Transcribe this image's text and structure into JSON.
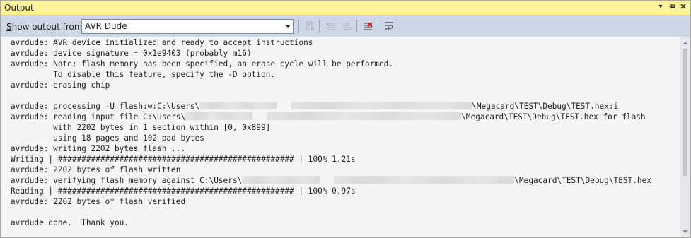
{
  "panel": {
    "title": "Output"
  },
  "toolbar": {
    "label_prefix": "",
    "label_accel": "S",
    "label_rest": "how output from:",
    "source_selected": "AVR Dude"
  },
  "output": {
    "lines": [
      "avrdude: AVR device initialized and ready to accept instructions",
      "avrdude: device signature = 0x1e9403 (probably m16)",
      "avrdude: Note: flash memory has been specified, an erase cycle will be performed.",
      "         To disable this feature, specify the -D option.",
      "avrdude: erasing chip",
      "",
      "avrdude: processing -U flash:w:C:\\Users\\",
      "avrdude: reading input file C:\\Users\\",
      "         with 2202 bytes in 1 section within [0, 0x899]",
      "         using 18 pages and 102 pad bytes",
      "avrdude: writing 2202 bytes flash ...",
      "Writing | ################################################## | 100% 1.21s",
      "avrdude: 2202 bytes of flash written",
      "avrdude: verifying flash memory against C:\\Users\\",
      "Reading | ################################################## | 100% 0.97s",
      "avrdude: 2202 bytes of flash verified",
      "",
      "avrdude done.  Thank you."
    ],
    "line_suffixes": {
      "6": "\\Megacard\\TEST\\Debug\\TEST.hex:i",
      "7": "\\Megacard\\TEST\\Debug\\TEST.hex for flash",
      "13": "\\Megacard\\TEST\\Debug\\TEST.hex"
    }
  },
  "icons": {
    "window_dropdown": "dropdown-icon",
    "pin": "pin-icon",
    "close": "close-icon",
    "find_message": "find-message-icon",
    "prev_message": "previous-message-icon",
    "next_message": "next-message-icon",
    "clear_all": "clear-all-icon",
    "word_wrap": "word-wrap-icon"
  }
}
